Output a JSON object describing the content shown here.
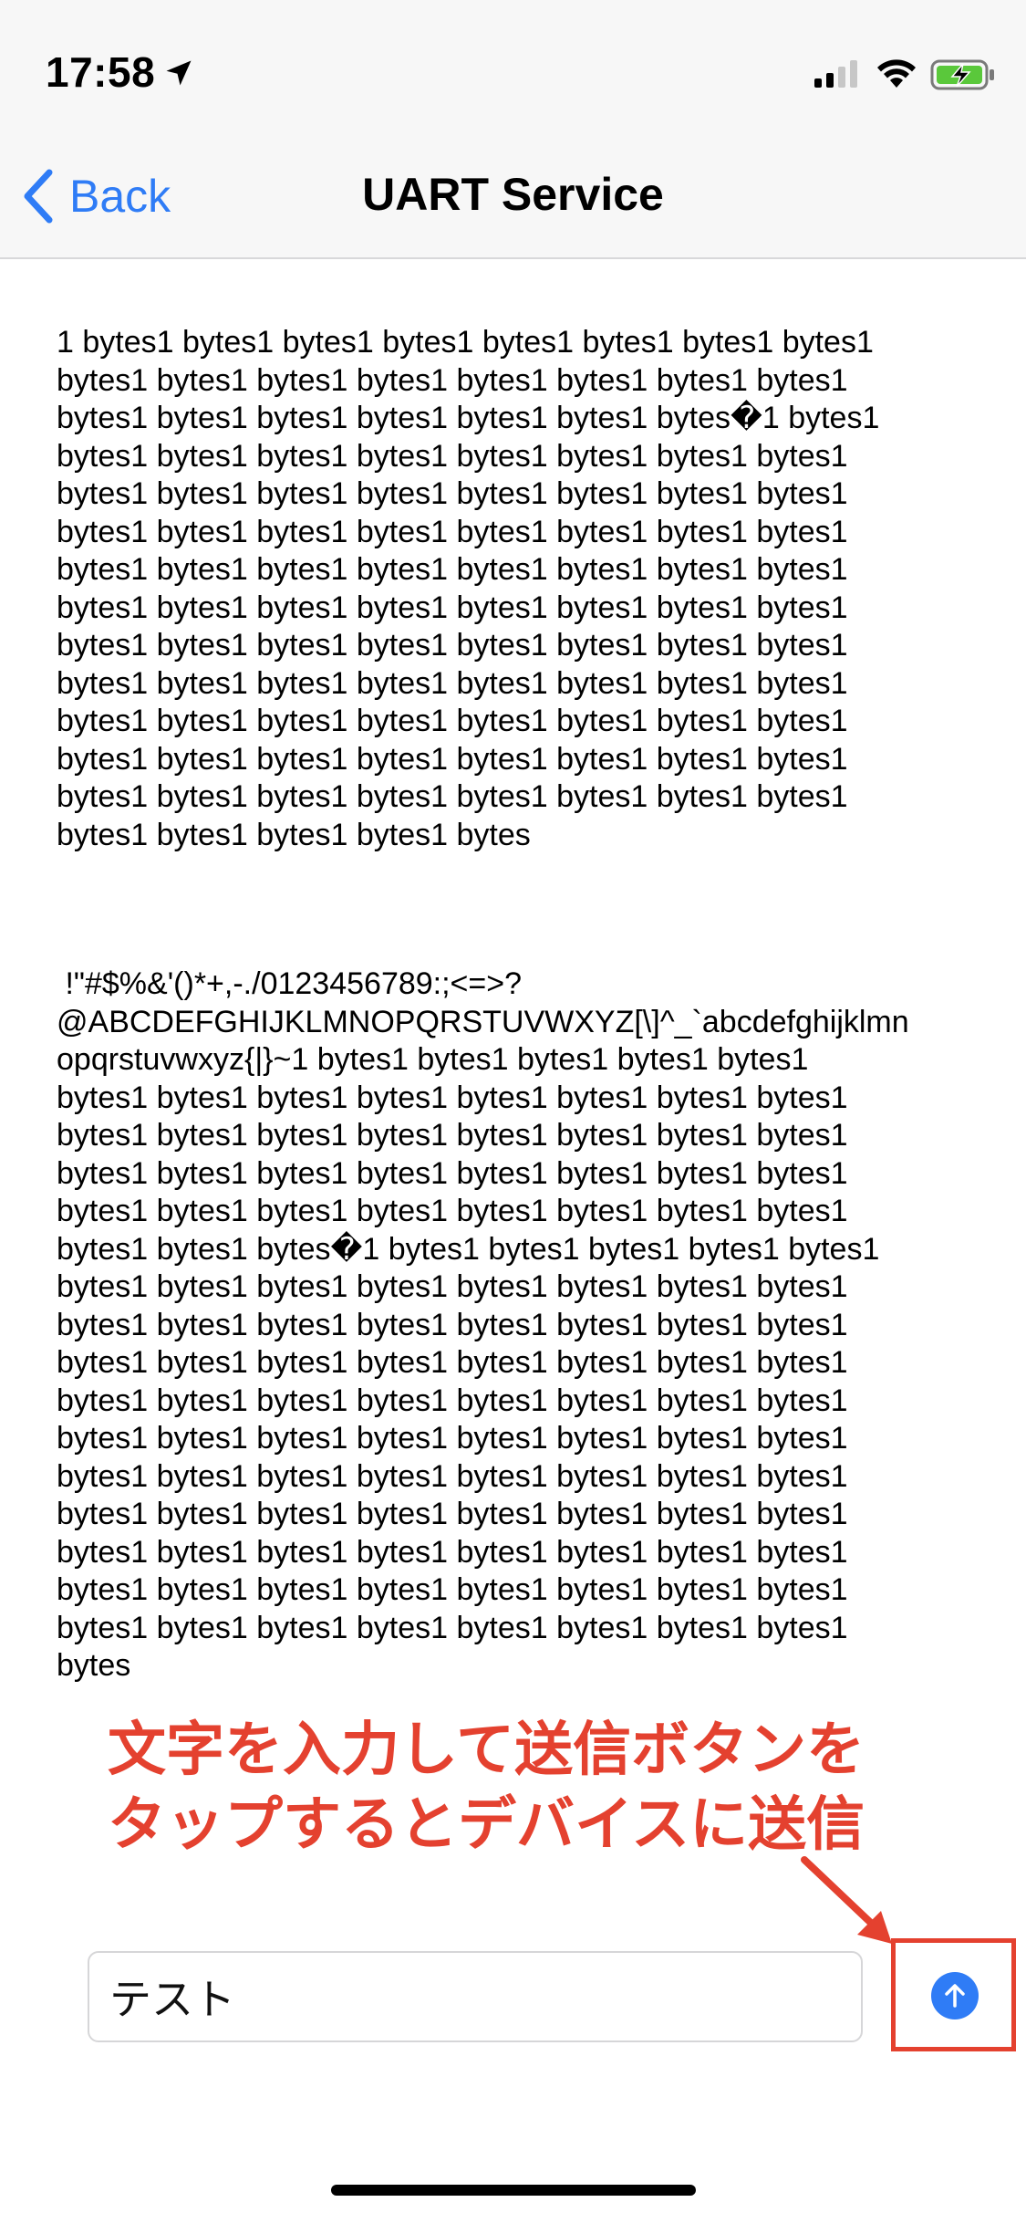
{
  "status_bar": {
    "time": "17:58",
    "icons": [
      "location-arrow-icon",
      "cellular-signal-icon",
      "wifi-icon",
      "battery-charging-icon"
    ],
    "battery_color": "#5ac83b"
  },
  "nav": {
    "back_label": "Back",
    "title": "UART Service",
    "accent_color": "#2f7cf6"
  },
  "received": {
    "block1": [
      "1 bytes1 bytes1 bytes1 bytes1 bytes1 bytes1 bytes1 bytes1",
      "bytes1 bytes1 bytes1 bytes1 bytes1 bytes1 bytes1 bytes1",
      "bytes1 bytes1 bytes1 bytes1 bytes1 bytes1 bytes�1 bytes1",
      "bytes1 bytes1 bytes1 bytes1 bytes1 bytes1 bytes1 bytes1",
      "bytes1 bytes1 bytes1 bytes1 bytes1 bytes1 bytes1 bytes1",
      "bytes1 bytes1 bytes1 bytes1 bytes1 bytes1 bytes1 bytes1",
      "bytes1 bytes1 bytes1 bytes1 bytes1 bytes1 bytes1 bytes1",
      "bytes1 bytes1 bytes1 bytes1 bytes1 bytes1 bytes1 bytes1",
      "bytes1 bytes1 bytes1 bytes1 bytes1 bytes1 bytes1 bytes1",
      "bytes1 bytes1 bytes1 bytes1 bytes1 bytes1 bytes1 bytes1",
      "bytes1 bytes1 bytes1 bytes1 bytes1 bytes1 bytes1 bytes1",
      "bytes1 bytes1 bytes1 bytes1 bytes1 bytes1 bytes1 bytes1",
      "bytes1 bytes1 bytes1 bytes1 bytes1 bytes1 bytes1 bytes1",
      "bytes1 bytes1 bytes1 bytes1 bytes"
    ],
    "block2": [
      " !\"#$%&'()*+,-./0123456789:;<=>?",
      "@ABCDEFGHIJKLMNOPQRSTUVWXYZ[\\]^_`abcdefghijklmn",
      "opqrstuvwxyz{|}~1 bytes1 bytes1 bytes1 bytes1 bytes1",
      "bytes1 bytes1 bytes1 bytes1 bytes1 bytes1 bytes1 bytes1",
      "bytes1 bytes1 bytes1 bytes1 bytes1 bytes1 bytes1 bytes1",
      "bytes1 bytes1 bytes1 bytes1 bytes1 bytes1 bytes1 bytes1",
      "bytes1 bytes1 bytes1 bytes1 bytes1 bytes1 bytes1 bytes1",
      "bytes1 bytes1 bytes�1 bytes1 bytes1 bytes1 bytes1 bytes1",
      "bytes1 bytes1 bytes1 bytes1 bytes1 bytes1 bytes1 bytes1",
      "bytes1 bytes1 bytes1 bytes1 bytes1 bytes1 bytes1 bytes1",
      "bytes1 bytes1 bytes1 bytes1 bytes1 bytes1 bytes1 bytes1",
      "bytes1 bytes1 bytes1 bytes1 bytes1 bytes1 bytes1 bytes1",
      "bytes1 bytes1 bytes1 bytes1 bytes1 bytes1 bytes1 bytes1",
      "bytes1 bytes1 bytes1 bytes1 bytes1 bytes1 bytes1 bytes1",
      "bytes1 bytes1 bytes1 bytes1 bytes1 bytes1 bytes1 bytes1",
      "bytes1 bytes1 bytes1 bytes1 bytes1 bytes1 bytes1 bytes1",
      "bytes1 bytes1 bytes1 bytes1 bytes1 bytes1 bytes1 bytes1",
      "bytes1 bytes1 bytes1 bytes1 bytes1 bytes1 bytes1 bytes1",
      "bytes"
    ]
  },
  "annotation": {
    "line1": "文字を入力して送信ボタンを",
    "line2": "タップするとデバイスに送信",
    "color": "#e4412f"
  },
  "composer": {
    "input_value": "テスト",
    "send_icon": "arrow-up-circle-icon"
  }
}
